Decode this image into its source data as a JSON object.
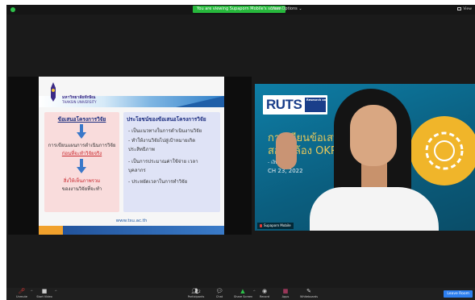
{
  "topbar": {
    "share_banner": "You are viewing Supaporn Mobile's screen",
    "view_options": "View Options ⌄",
    "view_label": "View"
  },
  "slide": {
    "university_th": "มหาวิทยาลัยทักษิณ",
    "university_en": "THAKSIN UNIVERSITY",
    "left_card": {
      "heading": "ข้อเสนอโครงการวิจัย",
      "line1": "การเขียนแผนการดำเนินการวิจัย",
      "line2": "ก่อนที่จะทำวิจัยจริง",
      "line3": "สิ่งให้เห็นภาพรวม",
      "line3_emph": "ภาพรวม",
      "line4": "ของงานวิจัยที่จะทำ"
    },
    "right_card": {
      "heading": "ประโยชน์ของข้อเสนอโครงการวิจัย",
      "items": [
        "- เป็นแนวทางในการดำเนินงานวิจัย",
        "- ทำให้งานวิจัยไปสู่เป้าหมายเกิด",
        "ประสิทธิภาพ",
        "- เป็นการประมาณค่าใช้จ่าย เวลา",
        "บุคลากร",
        "- ประหยัดเวลาในการทำวิจัย"
      ]
    },
    "website": "www.tsu.ac.th"
  },
  "video": {
    "brand": "RUTS",
    "research_tag": "Research and Development Institute",
    "title_line1": "การเขียนข้อเสนอ",
    "title_line2": "สอดคล้อง OKRs",
    "subtitle": "- เงินนายวิจัย",
    "date": "CH 23, 2022",
    "participant_name": "Supaporn Mobile"
  },
  "toolbar": {
    "mute": {
      "label": "Unmute",
      "icon": "microphone-muted-icon"
    },
    "video": {
      "label": "Start Video",
      "icon": "camera-icon"
    },
    "participants": {
      "label": "Participants",
      "count": "2",
      "icon": "people-icon"
    },
    "chat": {
      "label": "Chat",
      "icon": "chat-icon"
    },
    "share": {
      "label": "Share Screen",
      "icon": "share-screen-icon"
    },
    "record": {
      "label": "Record",
      "icon": "record-icon"
    },
    "reactions": {
      "label": "Reactions",
      "icon": "reactions-icon"
    },
    "apps": {
      "label": "Apps",
      "icon": "apps-icon"
    },
    "whiteboards": {
      "label": "Whiteboards",
      "icon": "whiteboard-icon"
    },
    "leave": "Leave Room"
  },
  "colors": {
    "share_green": "#27b83c",
    "leave_blue": "#2d7ff0",
    "slide_navy": "#1e2f80",
    "slide_red": "#c9262c",
    "video_teal": "#0b6a8e",
    "video_gold": "#e9c85a"
  }
}
